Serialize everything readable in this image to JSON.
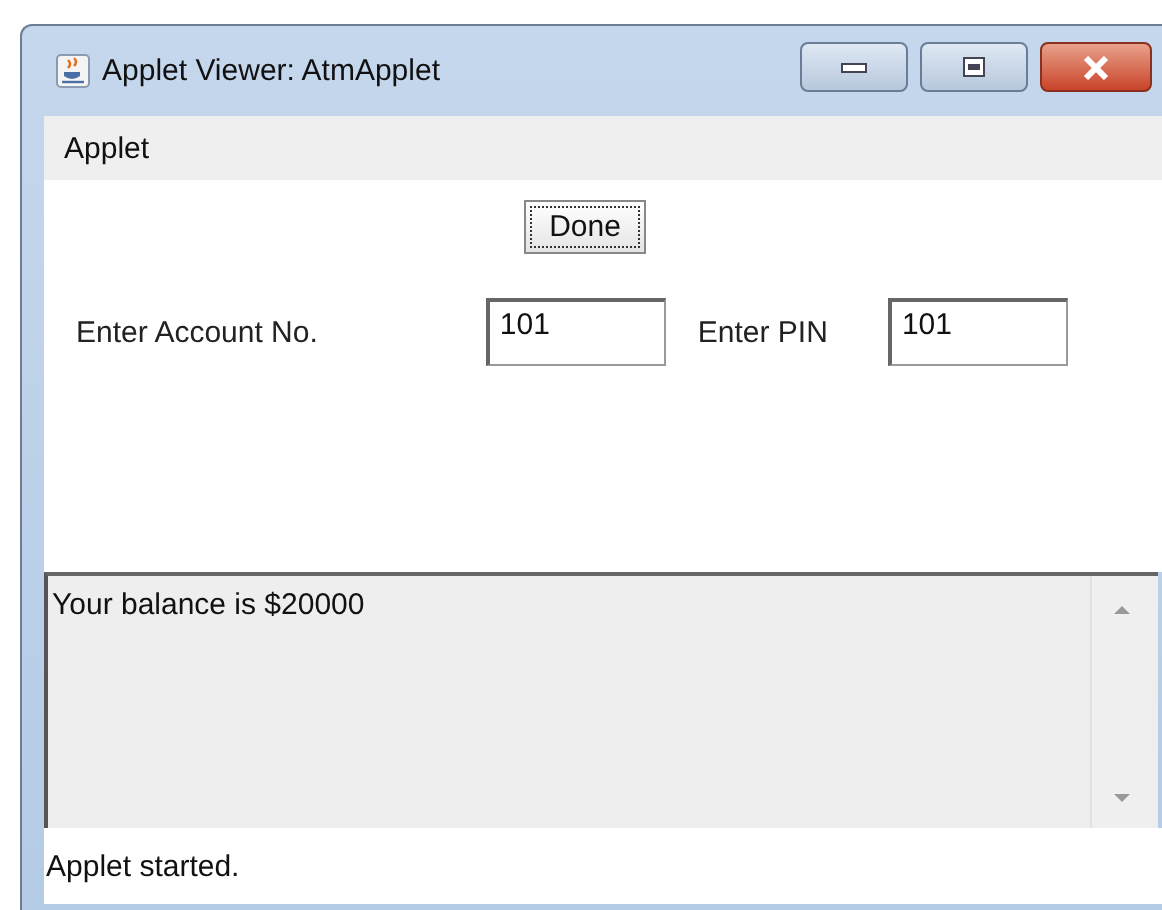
{
  "window": {
    "title": "Applet Viewer: AtmApplet"
  },
  "menu": [
    "Applet"
  ],
  "done_button": "Done",
  "fields": [
    {
      "label": "Enter Account No.",
      "value": "101"
    },
    {
      "label": "Enter PIN",
      "value": "101"
    }
  ],
  "output": "Your balance is $20000",
  "status_bar": "Applet started."
}
